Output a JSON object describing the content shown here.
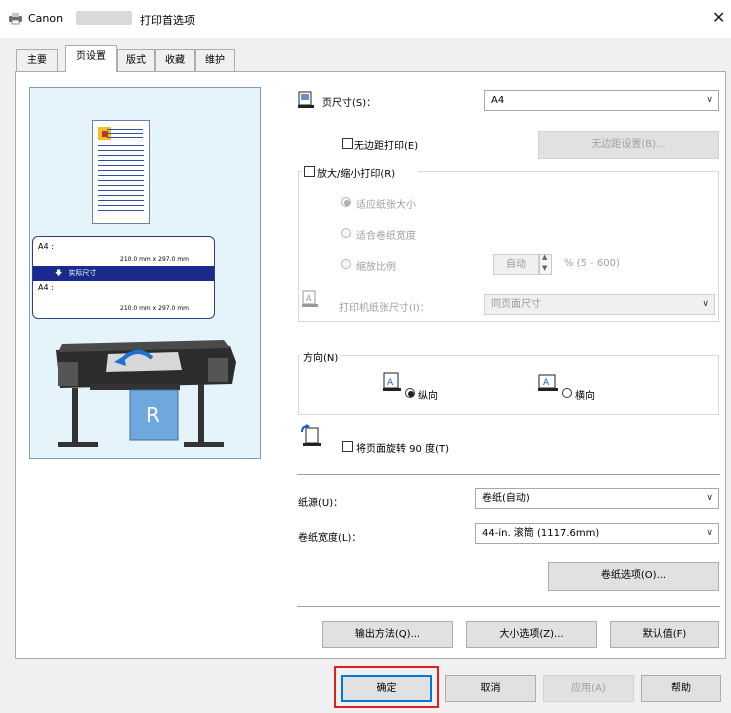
{
  "window": {
    "title_left": "Canon",
    "title_right": "打印首选项",
    "close_glyph": "✕"
  },
  "tabs": [
    {
      "label": "主要"
    },
    {
      "label": "页设置"
    },
    {
      "label": "版式"
    },
    {
      "label": "收藏"
    },
    {
      "label": "维护"
    }
  ],
  "preview": {
    "size_from_label": "A4 :",
    "size_from_value": "210.0 mm x 297.0 mm",
    "arrow_label": "实际尺寸",
    "size_to_label": "A4 :",
    "size_to_value": "210.0 mm x 297.0 mm"
  },
  "page_size": {
    "label": "页尺寸(S)：",
    "value": "A4"
  },
  "borderless": {
    "checkbox_label": "无边距打印(E)",
    "checked": false,
    "button_label": "无边距设置(B)..."
  },
  "scaling": {
    "checkbox_label": "放大/缩小打印(R)",
    "checked": false,
    "options": [
      {
        "label": "适应纸张大小",
        "selected": true
      },
      {
        "label": "适合卷纸宽度",
        "selected": false
      },
      {
        "label": "缩放比例",
        "selected": false
      }
    ],
    "scale_value": "自动",
    "scale_range": "% (5 - 600)",
    "printer_paper_label": "打印机纸张尺寸(I)：",
    "printer_paper_value": "同页面尺寸"
  },
  "orientation": {
    "group_label": "方向(N)",
    "portrait_label": "纵向",
    "landscape_label": "横向",
    "selected": "portrait"
  },
  "rotate": {
    "checkbox_label": "将页面旋转 90 度(T)",
    "checked": false
  },
  "paper_source": {
    "label": "纸源(U)：",
    "value": "卷纸(自动)"
  },
  "roll_width": {
    "label": "卷纸宽度(L)：",
    "value": "44-in. 滚筒 (1117.6mm)"
  },
  "roll_options_button": "卷纸选项(O)...",
  "bottom_buttons": {
    "output_method": "输出方法(Q)...",
    "size_options": "大小选项(Z)...",
    "defaults": "默认值(F)"
  },
  "dialog_buttons": {
    "ok": "确定",
    "cancel": "取消",
    "apply": "应用(A)",
    "help": "帮助"
  }
}
